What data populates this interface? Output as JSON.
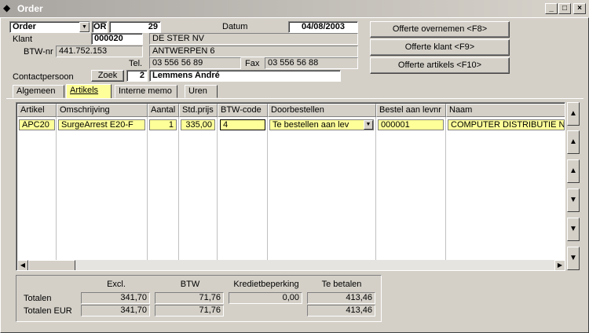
{
  "window": {
    "title": "Order"
  },
  "header": {
    "doc_type": "Order",
    "doc_prefix": "OR",
    "doc_number": "29",
    "date_label": "Datum",
    "date_value": "04/08/2003",
    "client_label": "Klant",
    "client_code": "000020",
    "client_name": "DE STER NV",
    "client_city": "ANTWERPEN 6",
    "vat_label": "BTW-nr",
    "vat_value": "441.752.153",
    "tel_label": "Tel.",
    "tel_value": "03 556 56 89",
    "fax_label": "Fax",
    "fax_value": "03 556 56 88",
    "contact_label": "Contactpersoon",
    "search_button": "Zoek",
    "contact_number": "2",
    "contact_name": "Lemmens André"
  },
  "actions": {
    "quote_import": "Offerte overnemen <F8>",
    "quote_client": "Offerte klant <F9>",
    "quote_articles": "Offerte artikels <F10>"
  },
  "tabs": [
    {
      "label": "Algemeen",
      "active": false
    },
    {
      "label": "Artikels",
      "active": true
    },
    {
      "label": "Interne memo",
      "active": false
    },
    {
      "label": "Uren",
      "active": false
    }
  ],
  "grid": {
    "columns": [
      "Artikel",
      "Omschrijving",
      "Aantal",
      "Std.prijs",
      "BTW-code",
      "Doorbestellen",
      "Bestel aan levnr",
      "Naam"
    ],
    "rows": [
      {
        "artikel": "APC20",
        "omschrijving": "SurgeArrest E20-F",
        "aantal": "1",
        "std_prijs": "335,00",
        "btw_code": "4",
        "doorbestellen": "Te bestellen aan lev",
        "bestel_levnr": "000001",
        "naam": "COMPUTER DISTRIBUTIE NV"
      }
    ]
  },
  "totals": {
    "col_excl": "Excl.",
    "col_btw": "BTW",
    "col_credit": "Kredietbeperking",
    "col_pay": "Te betalen",
    "row1_label": "Totalen",
    "row1_excl": "341,70",
    "row1_btw": "71,76",
    "row1_credit": "0,00",
    "row1_pay": "413,46",
    "row2_label": "Totalen EUR",
    "row2_excl": "341,70",
    "row2_btw": "71,76",
    "row2_pay": "413,46"
  },
  "icons": {
    "app": "app-diamond-icon",
    "minimize": "minimize-icon",
    "maximize": "maximize-icon",
    "close": "close-icon"
  }
}
